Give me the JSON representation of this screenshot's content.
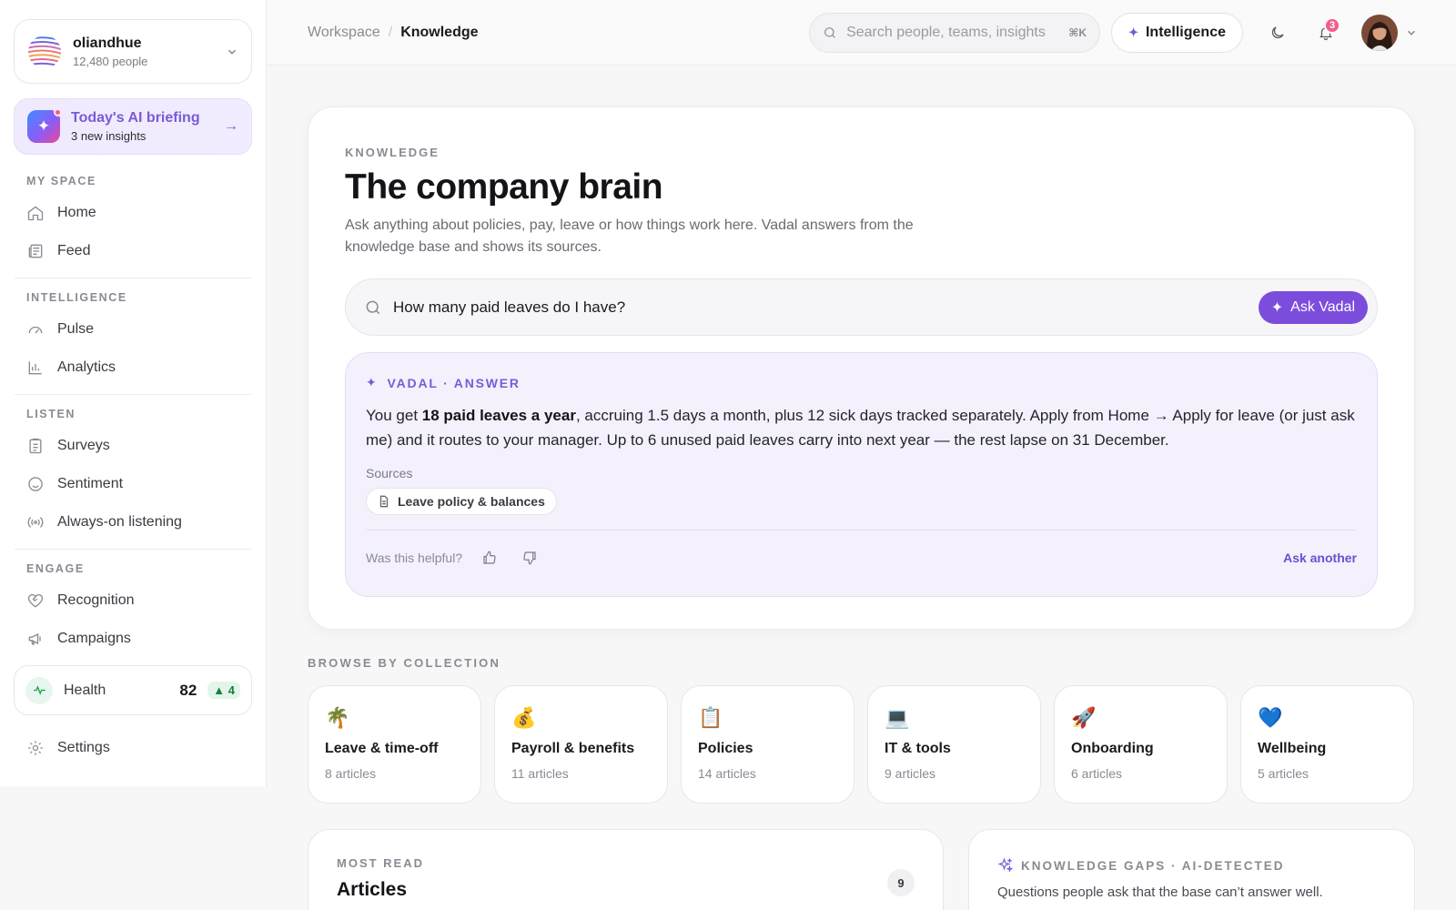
{
  "org": {
    "name": "oliandhue",
    "people": "12,480 people"
  },
  "briefing": {
    "title": "Today's AI briefing",
    "subtitle": "3 new insights"
  },
  "sidebar": {
    "sections": [
      {
        "label": "MY SPACE",
        "items": [
          "Home",
          "Feed"
        ]
      },
      {
        "label": "INTELLIGENCE",
        "items": [
          "Pulse",
          "Analytics"
        ]
      },
      {
        "label": "LISTEN",
        "items": [
          "Surveys",
          "Sentiment",
          "Always-on listening"
        ]
      },
      {
        "label": "ENGAGE",
        "items": [
          "Recognition",
          "Campaigns"
        ]
      }
    ],
    "health": {
      "label": "Health",
      "value": "82",
      "delta": "▲ 4"
    },
    "settings": "Settings"
  },
  "topbar": {
    "crumb_root": "Workspace",
    "crumb_sep": "/",
    "crumb_current": "Knowledge",
    "search_placeholder": "Search people, teams, insights",
    "search_shortcut": "⌘K",
    "intelligence_label": "Intelligence",
    "notifications_count": "3"
  },
  "hero": {
    "eyebrow": "KNOWLEDGE",
    "title": "The company brain",
    "subtitle": "Ask anything about policies, pay, leave or how things work here. Vadal answers from the knowledge base and shows its sources.",
    "query": "How many paid leaves do I have?",
    "ask_button": "Ask Vadal"
  },
  "answer": {
    "label": "VADAL · ANSWER",
    "text_before": "You get ",
    "text_bold": "18 paid leaves a year",
    "text_after": ", accruing 1.5 days a month, plus 12 sick days tracked separately. Apply from Home → Apply for leave (or just ask me) and it routes to your manager. Up to 6 unused paid leaves carry into next year — the rest lapse on 31 December.",
    "sources_label": "Sources",
    "source": "Leave policy & balances",
    "helpful_label": "Was this helpful?",
    "ask_another": "Ask another"
  },
  "collections": {
    "label": "BROWSE BY COLLECTION",
    "items": [
      {
        "emoji": "🌴",
        "name": "Leave & time-off",
        "count": "8 articles"
      },
      {
        "emoji": "💰",
        "name": "Payroll & benefits",
        "count": "11 articles"
      },
      {
        "emoji": "📋",
        "name": "Policies",
        "count": "14 articles"
      },
      {
        "emoji": "💻",
        "name": "IT & tools",
        "count": "9 articles"
      },
      {
        "emoji": "🚀",
        "name": "Onboarding",
        "count": "6 articles"
      },
      {
        "emoji": "💙",
        "name": "Wellbeing",
        "count": "5 articles"
      }
    ]
  },
  "most_read": {
    "eyebrow": "MOST READ",
    "title": "Articles",
    "count": "9"
  },
  "gaps": {
    "eyebrow": "KNOWLEDGE GAPS · AI-DETECTED",
    "subtitle": "Questions people ask that the base can’t answer well."
  }
}
